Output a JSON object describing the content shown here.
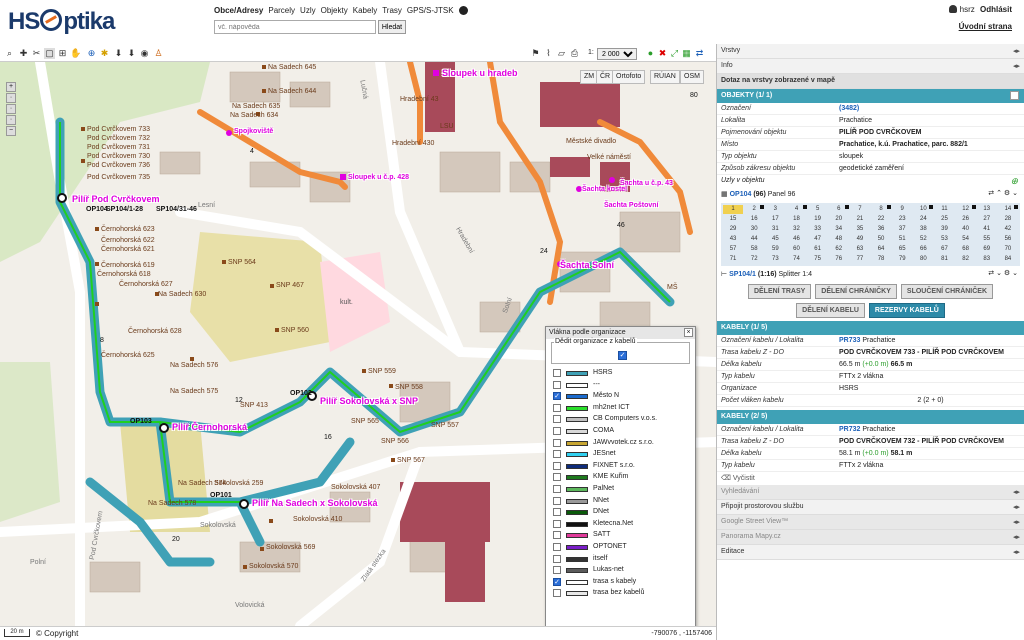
{
  "header": {
    "logo": "HSOptika",
    "nav": [
      "Obce/Adresy",
      "Parcely",
      "Uzly",
      "Objekty",
      "Kabely",
      "Trasy",
      "GPS/S-JTSK"
    ],
    "search_placeholder": "vč. nápověda",
    "search_button": "Hledat",
    "user": "hsrz",
    "logout": "Odhlásit",
    "homepage": "Úvodní strana"
  },
  "toolbar": {
    "scale_prefix": "1:",
    "scale_value": "2 000"
  },
  "map": {
    "basemaps": [
      "ZM",
      "ČR",
      "Ortofoto",
      "RÚIAN",
      "OSM"
    ],
    "sites": [
      {
        "label": "Pilíř Pod Cvrčkovem"
      },
      {
        "label": "Pilíř Černohorská"
      },
      {
        "label": "Pilíř Sokolovská x SNP"
      },
      {
        "label": "Pilíř Na Sadech x Sokolovská"
      },
      {
        "label": "Sloupek u hradeb"
      },
      {
        "label": "Sloupek u č.p. 428"
      },
      {
        "label": "Spojkoviště"
      },
      {
        "label": "Šachta Solní"
      },
      {
        "label": "Šachta u č.p. 43"
      },
      {
        "label": "Šachta Poštovní"
      },
      {
        "label": "Šachta kostel"
      }
    ],
    "addresses": [
      "Na Sadech 645",
      "Na Sadech 644",
      "Na Sadech 635",
      "Na Sadech 634",
      "Pod Cvrčkovem 733",
      "Pod Cvrčkovem 732",
      "Pod Cvrčkovem 731",
      "Pod Cvrčkovem 730",
      "Pod Cvrčkovem 736",
      "Pod Cvrčkovem 735",
      "Černohorská 623",
      "Černohorská 622",
      "Černohorská 621",
      "Černohorská 619",
      "Černohorská 618",
      "Černohorská 627",
      "Černohorská 628",
      "Černohorská 625",
      "Na Sadech 630",
      "Na Sadech 576",
      "Na Sadech 575",
      "Na Sadech 574",
      "Na Sadech 578",
      "SNP 564",
      "SNP 467",
      "SNP 560",
      "SNP 559",
      "SNP 558",
      "SNP 565",
      "SNP 566",
      "SNP 567",
      "SNP 557",
      "SNP 413",
      "Sokolovská 407",
      "Sokolovská 410",
      "Sokolovská 569",
      "Sokolovská 570",
      "Sokolovská 259",
      "Hradební 43",
      "Hradební 430",
      "LSU",
      "Městské divadlo",
      "Velké náměstí",
      "MŠ",
      "kult."
    ],
    "streets": [
      "Lesní",
      "Hradební",
      "Solní",
      "Sokolovská",
      "Zlatá stezka",
      "Volovická",
      "Polní",
      "Pod Cvrčkovem",
      "Lučná"
    ],
    "node_labels": [
      "OP104",
      "OP103",
      "OP102",
      "OP101",
      "SP104/1-28",
      "SP104/31-46"
    ],
    "numbers": [
      "4",
      "8",
      "12",
      "16",
      "20",
      "24",
      "46",
      "80"
    ]
  },
  "fiber_popup": {
    "title": "Vlákna podle organizace",
    "inherit_label": "Dědit organizace z kabelů",
    "inherit_checked": true,
    "organizations": [
      {
        "name": "HSRS",
        "color": "#3fa1b6",
        "checked": false
      },
      {
        "name": "---",
        "color": "#ffffff",
        "checked": false
      },
      {
        "name": "Město N",
        "color": "#1a6acd",
        "checked": true
      },
      {
        "name": "mh2net ICT",
        "color": "#2bdf2b",
        "checked": false
      },
      {
        "name": "CB Computers v.o.s.",
        "color": "#c0c0c0",
        "checked": false
      },
      {
        "name": "COMA",
        "color": "#d8d8d8",
        "checked": false
      },
      {
        "name": "JAWvvotek.cz s.r.o.",
        "color": "#c8a632",
        "checked": false
      },
      {
        "name": "JESnet",
        "color": "#30d0f0",
        "checked": false
      },
      {
        "name": "FIXNET s.r.o.",
        "color": "#0d2b7a",
        "checked": false
      },
      {
        "name": "KME Kuřim",
        "color": "#1e7a1e",
        "checked": false
      },
      {
        "name": "PalNet",
        "color": "#5cb85c",
        "checked": false
      },
      {
        "name": "NNet",
        "color": "#999999",
        "checked": false
      },
      {
        "name": "DNet",
        "color": "#0a5a0a",
        "checked": false
      },
      {
        "name": "Kletecna.Net",
        "color": "#111111",
        "checked": false
      },
      {
        "name": "SATT",
        "color": "#e03a9a",
        "checked": false
      },
      {
        "name": "OPTONET",
        "color": "#7a1ec8",
        "checked": false
      },
      {
        "name": "itself",
        "color": "#333333",
        "checked": false
      },
      {
        "name": "Lukas-net",
        "color": "#5a5a5a",
        "checked": false
      },
      {
        "name": "trasa s kabely",
        "color": "#ffffff",
        "checked": true
      },
      {
        "name": "trasa bez kabelů",
        "color": "#e8e8e8",
        "checked": false
      }
    ]
  },
  "status": {
    "scale": "20 m",
    "copyright": "© Copyright",
    "coords": "-790076 , -1157406"
  },
  "side": {
    "accordions_top": [
      "Vrstvy",
      "Info"
    ],
    "query_title": "Dotaz na vrstvy zobrazené v mapě",
    "objects_title": "OBJEKTY (1/ 1)",
    "object": {
      "id_label": "Označení",
      "id_value": "(3482)",
      "rows": [
        {
          "k": "Lokalita",
          "v": "Prachatice",
          "bold": false
        },
        {
          "k": "Pojmenování objektu",
          "v": "PILÍŘ POD CVRČKOVEM",
          "bold": true
        },
        {
          "k": "Místo",
          "v": "Prachatice, k.ú. Prachatice, parc. 882/1",
          "bold": true
        },
        {
          "k": "Typ objektu",
          "v": "sloupek",
          "bold": false
        },
        {
          "k": "Způsob zákresu objektu",
          "v": "geodetické zaměření",
          "bold": false
        }
      ]
    },
    "nodes_label": "Uzly v objektu",
    "panel_label": "OP104",
    "panel_count": "(96)",
    "panel_desc": "Panel 96",
    "panel_numbers": [
      "1",
      "2",
      "3",
      "4",
      "5",
      "6",
      "7",
      "8",
      "9",
      "10",
      "11",
      "12",
      "13",
      "14",
      "15",
      "16",
      "17",
      "18",
      "19",
      "20",
      "21",
      "22",
      "23",
      "24",
      "25",
      "26",
      "27",
      "28",
      "29",
      "30",
      "31",
      "32",
      "33",
      "34",
      "35",
      "36",
      "37",
      "38",
      "39",
      "40",
      "41",
      "42",
      "43",
      "44",
      "45",
      "46",
      "47",
      "48",
      "49",
      "50",
      "51",
      "52",
      "53",
      "54",
      "55",
      "56",
      "57",
      "58",
      "59",
      "60",
      "61",
      "62",
      "63",
      "64",
      "65",
      "66",
      "67",
      "68",
      "69",
      "70",
      "71",
      "72",
      "73",
      "74",
      "75",
      "76",
      "77",
      "78",
      "79",
      "80",
      "81",
      "82",
      "83",
      "84"
    ],
    "splitter_label": "SP104/1",
    "splitter_ratio": "(1:16)",
    "splitter_desc": "Splitter 1:4",
    "buttons": [
      "DĚLENÍ TRASY",
      "DĚLENÍ CHRÁNIČKY",
      "SLOUČENÍ CHRÁNIČEK",
      "DĚLENÍ KABELU",
      "REZERVY KABELŮ"
    ],
    "cables": [
      {
        "title": "KABELY (1/ 5)",
        "id": "PR733",
        "locality": "Prachatice",
        "route": "POD CVRČKOVEM 733 - PILÍŘ POD CVRČKOVEM",
        "length": "66.5 m",
        "length_delta": "(+0.0 m)",
        "length_total": "66.5 m",
        "type": "FTTx 2 vlákna",
        "org": "HSRS",
        "fibers": "2 (2 + 0)"
      },
      {
        "title": "KABELY (2/ 5)",
        "id": "PR732",
        "locality": "Prachatice",
        "route": "POD CVRČKOVEM 732 - PILÍŘ POD CVRČKOVEM",
        "length": "58.1 m",
        "length_delta": "(+0.0 m)",
        "length_total": "58.1 m",
        "type": "FTTx 2 vlákna"
      }
    ],
    "cable_labels": {
      "id": "Označení kabelu / Lokalita",
      "route": "Trasa kabelu Z - DO",
      "length": "Délka kabelu",
      "type": "Typ kabelu",
      "org": "Organizace",
      "fibers": "Počet vláken kabelu"
    },
    "clear": "Vyčistit",
    "accordions_bottom": [
      "Vyhledávání",
      "Připojit prostorovou službu",
      "Google Street View™",
      "Panorama Mapy.cz",
      "Editace"
    ]
  }
}
